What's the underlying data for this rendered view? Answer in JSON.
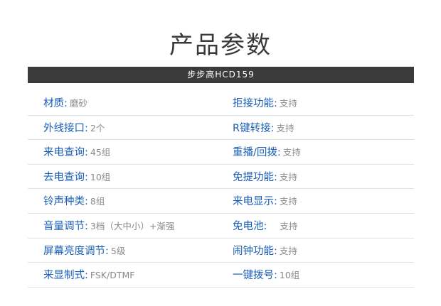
{
  "page": {
    "title": "产品参数",
    "model": "步步高HCD159"
  },
  "specs": [
    {
      "left": {
        "label": "材质:",
        "value": "磨砂"
      },
      "right": {
        "label": "拒接功能:",
        "value": "支持"
      }
    },
    {
      "left": {
        "label": "外线接口:",
        "value": "2个"
      },
      "right": {
        "label": "R键转接:",
        "value": "支持"
      }
    },
    {
      "left": {
        "label": "来电查询:",
        "value": "45组"
      },
      "right": {
        "label": "重播/回拨:",
        "value": "支持"
      }
    },
    {
      "left": {
        "label": "去电查询:",
        "value": "10组"
      },
      "right": {
        "label": "免提功能:",
        "value": "支持"
      }
    },
    {
      "left": {
        "label": "铃声种类:",
        "value": "8组"
      },
      "right": {
        "label": "来电显示:",
        "value": "支持"
      }
    },
    {
      "left": {
        "label": "音量调节:",
        "value": "3档（大中小）+渐强"
      },
      "right": {
        "label": "免电池:",
        "value": "支持"
      }
    },
    {
      "left": {
        "label": "屏幕亮度调节:",
        "value": "5级"
      },
      "right": {
        "label": "闹钟功能:",
        "value": "支持"
      }
    },
    {
      "left": {
        "label": "来显制式:",
        "value": "FSK/DTMF"
      },
      "right": {
        "label": "一键拨号:",
        "value": "10组"
      }
    }
  ]
}
